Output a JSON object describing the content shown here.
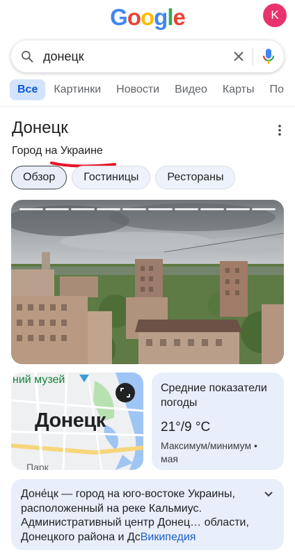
{
  "header": {
    "logo_letters": [
      {
        "ch": "G",
        "color": "#4285F4"
      },
      {
        "ch": "o",
        "color": "#EA4335"
      },
      {
        "ch": "o",
        "color": "#FBBC05"
      },
      {
        "ch": "g",
        "color": "#4285F4"
      },
      {
        "ch": "l",
        "color": "#34A853"
      },
      {
        "ch": "e",
        "color": "#EA4335"
      }
    ],
    "avatar_letter": "K",
    "avatar_color": "#E8336D"
  },
  "search": {
    "query": "донецк",
    "search_icon": "search-icon",
    "clear_icon": "close-icon",
    "mic_icon": "mic-icon"
  },
  "tabs": [
    "Все",
    "Картинки",
    "Новости",
    "Видео",
    "Карты",
    "По"
  ],
  "knowledge_panel": {
    "title": "Донецк",
    "subtitle": "Город на Украине",
    "annotation_color": "#E8132A",
    "chips": [
      "Обзор",
      "Гостиницы",
      "Рестораны"
    ],
    "photo_segments": 10
  },
  "map": {
    "museum_label": "ний музей",
    "city_label": "Донецк",
    "park_label": "Парк"
  },
  "weather": {
    "title": "Средние показатели погоды",
    "temperature": "21°/9 °C",
    "note": "Максимум/минимум • мая"
  },
  "description": {
    "text": "Доне́цк — город на юго-востоке Украины, расположенный на реке Кальмиус. Административный центр Донец… области, Донецкого района и Дс",
    "link": "Википедия"
  }
}
